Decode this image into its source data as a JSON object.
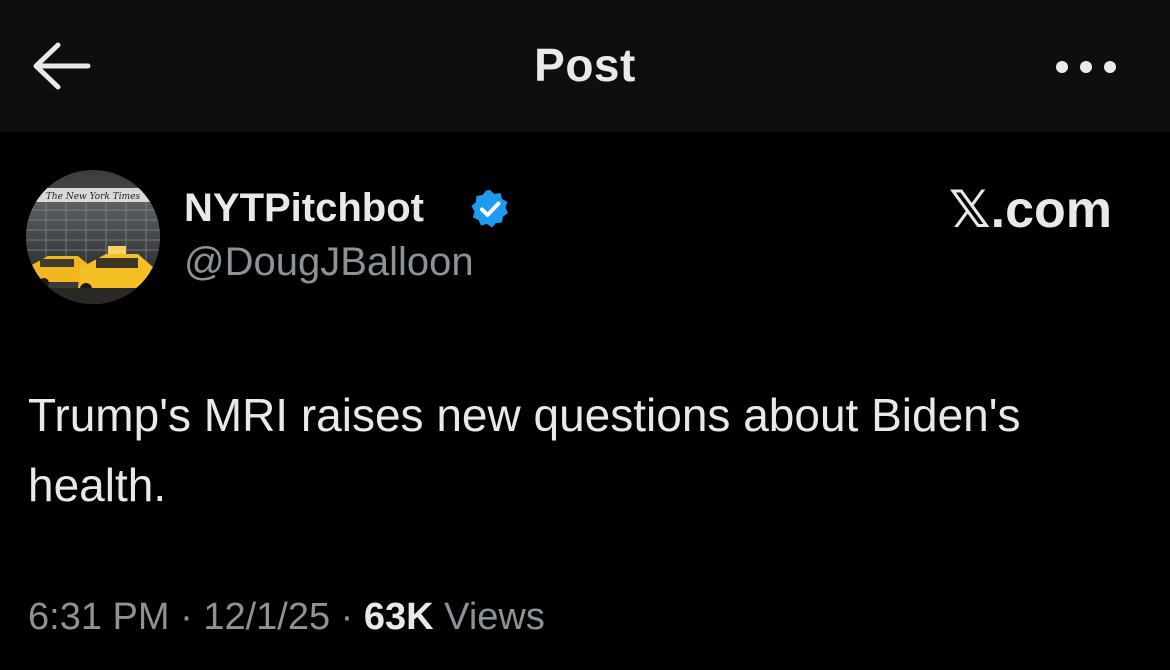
{
  "header": {
    "title": "Post",
    "back_icon": "arrow-left-icon",
    "more_icon": "more-horizontal-icon"
  },
  "author": {
    "display_name": "NYTPitchbot",
    "handle": "@DougJBalloon",
    "verified": true,
    "avatar_masthead": "The New York Times"
  },
  "source": {
    "label": "𝕏.com"
  },
  "post": {
    "text": "Trump's MRI raises new questions about Biden's health."
  },
  "meta": {
    "time": "6:31 PM",
    "sep1": " · ",
    "date": "12/1/25",
    "sep2": " · ",
    "views_count": "63K",
    "views_label": " Views"
  },
  "colors": {
    "background": "#000000",
    "header_background": "#0e0e0e",
    "primary_text": "#e7e9ea",
    "secondary_text": "#8b9298",
    "verified_blue": "#1d9bf0"
  }
}
